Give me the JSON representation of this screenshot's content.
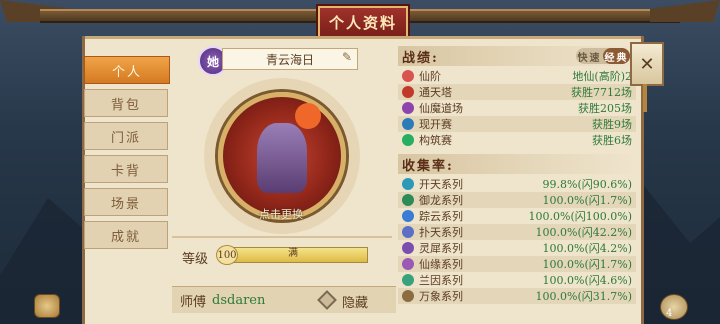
{
  "window": {
    "title": "个人资料"
  },
  "tabs": [
    {
      "label": "个人",
      "active": true
    },
    {
      "label": "背包",
      "active": false
    },
    {
      "label": "门派",
      "active": false
    },
    {
      "label": "卡背",
      "active": false
    },
    {
      "label": "场景",
      "active": false
    },
    {
      "label": "成就",
      "active": false
    }
  ],
  "profile": {
    "badge_text": "她",
    "name": "青云海日",
    "change_label": "点击更换",
    "level_label": "等级",
    "level_value": "100",
    "level_bar_text": "满",
    "level_fraction": 1.0,
    "master_label": "师傅",
    "master_name": "dsdaren",
    "hide_label": "隐藏"
  },
  "record": {
    "heading": "战绩:",
    "mode_options": [
      "快速",
      "经典"
    ],
    "mode_selected": "经典",
    "rows": [
      {
        "label": "仙阶",
        "value": "地仙(高阶)2",
        "icon": "star-icon",
        "color": "#d9534f"
      },
      {
        "label": "通天塔",
        "value": "获胜7712场",
        "icon": "tower-icon",
        "color": "#c0392b"
      },
      {
        "label": "仙魔道场",
        "value": "获胜205场",
        "icon": "arena-icon",
        "color": "#8e44ad"
      },
      {
        "label": "现开赛",
        "value": "获胜9场",
        "icon": "match-icon",
        "color": "#2c7bb6"
      },
      {
        "label": "构筑赛",
        "value": "获胜6场",
        "icon": "build-icon",
        "color": "#27ae60"
      }
    ]
  },
  "collection": {
    "heading": "收集率:",
    "rows": [
      {
        "label": "开天系列",
        "value": "99.8%(闪90.6%)",
        "icon": "series-kaitian-icon",
        "color": "#2c9ab7"
      },
      {
        "label": "御龙系列",
        "value": "100.0%(闪1.7%)",
        "icon": "series-yulong-icon",
        "color": "#2e8b57"
      },
      {
        "label": "踪云系列",
        "value": "100.0%(闪100.0%)",
        "icon": "series-zongyun-icon",
        "color": "#3a7bd5"
      },
      {
        "label": "扑天系列",
        "value": "100.0%(闪42.2%)",
        "icon": "series-putian-icon",
        "color": "#5b6fc7"
      },
      {
        "label": "灵犀系列",
        "value": "100.0%(闪4.2%)",
        "icon": "series-lingxi-icon",
        "color": "#7a4fb0"
      },
      {
        "label": "仙缘系列",
        "value": "100.0%(闪1.7%)",
        "icon": "series-xianyuan-icon",
        "color": "#9b59b6"
      },
      {
        "label": "兰因系列",
        "value": "100.0%(闪4.6%)",
        "icon": "series-lanyin-icon",
        "color": "#3aa17e"
      },
      {
        "label": "万象系列",
        "value": "100.0%(闪31.7%)",
        "icon": "series-wanxiang-icon",
        "color": "#8c6d3f"
      }
    ]
  },
  "corner": {
    "right_count": "4"
  },
  "colors": {
    "accent": "#d57a22",
    "panel": "#efe4cc",
    "text": "#5b3d22",
    "value_green": "#2e7a3a"
  }
}
